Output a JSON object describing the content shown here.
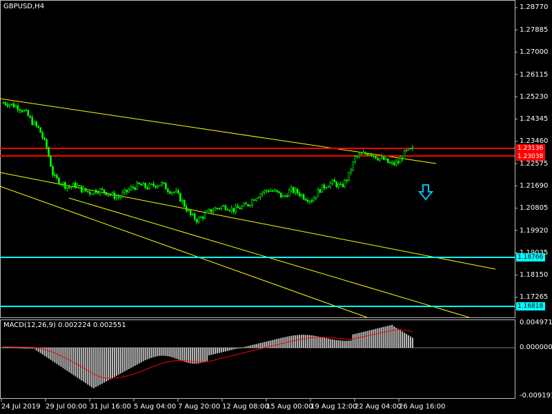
{
  "window": {
    "title": "GBPUSD,H4"
  },
  "macd": {
    "label": "MACD(12,26,9) 0.002224 0.002551",
    "axis_labels": [
      "0.004971",
      "0.000000",
      "-0.009191"
    ],
    "values": {
      "max": 0.004971,
      "min": -0.009191
    }
  },
  "price_axis": {
    "labels": [
      "1.28770",
      "1.27885",
      "1.27000",
      "1.26115",
      "1.25230",
      "1.24345",
      "1.23460",
      "1.22575",
      "1.21690",
      "1.20805",
      "1.19920",
      "1.19035",
      "1.18150",
      "1.17265"
    ],
    "max": 1.2877,
    "min": 1.1682
  },
  "time_axis": {
    "labels": [
      "24 Jul 2019",
      "29 Jul 00:00",
      "31 Jul 16:00",
      "5 Aug 04:00",
      "7 Aug 20:00",
      "12 Aug 08:00",
      "15 Aug 00:00",
      "19 Aug 12:00",
      "22 Aug 04:00",
      "26 Aug 16:00"
    ]
  },
  "price_levels": {
    "red": [
      "1.23136",
      "1.23038"
    ],
    "cyan": [
      "1.18766",
      "1.16818"
    ]
  },
  "colors": {
    "background": "#000000",
    "bull_candle": "#00ff00",
    "bear_candle": "#00ff00",
    "trendline": "#ffff00",
    "resistance": "#ff0000",
    "support": "#00ffff",
    "macd_hist": "#c0c0c0",
    "macd_signal": "#ff0000",
    "arrow": "#00bfff"
  },
  "signal": {
    "icon": "down-arrow-icon"
  },
  "chart_data": {
    "type": "candlestick",
    "symbol": "GBPUSD",
    "timeframe": "H4",
    "close_path": [
      1.2497,
      1.249,
      1.248,
      1.246,
      1.242,
      1.239,
      1.232,
      1.22,
      1.218,
      1.216,
      1.217,
      1.215,
      1.214,
      1.215,
      1.2145,
      1.213,
      1.212,
      1.214,
      1.216,
      1.217,
      1.216,
      1.217,
      1.2175,
      1.215,
      1.214,
      1.21,
      1.205,
      1.203,
      1.205,
      1.207,
      1.208,
      1.2085,
      1.207,
      1.208,
      1.209,
      1.212,
      1.214,
      1.215,
      1.214,
      1.212,
      1.215,
      1.214,
      1.212,
      1.211,
      1.215,
      1.217,
      1.218,
      1.216,
      1.22,
      1.228,
      1.229,
      1.23,
      1.228,
      1.227,
      1.225,
      1.226,
      1.23,
      1.231
    ],
    "ylim": [
      1.1682,
      1.2877
    ],
    "grid": false
  }
}
